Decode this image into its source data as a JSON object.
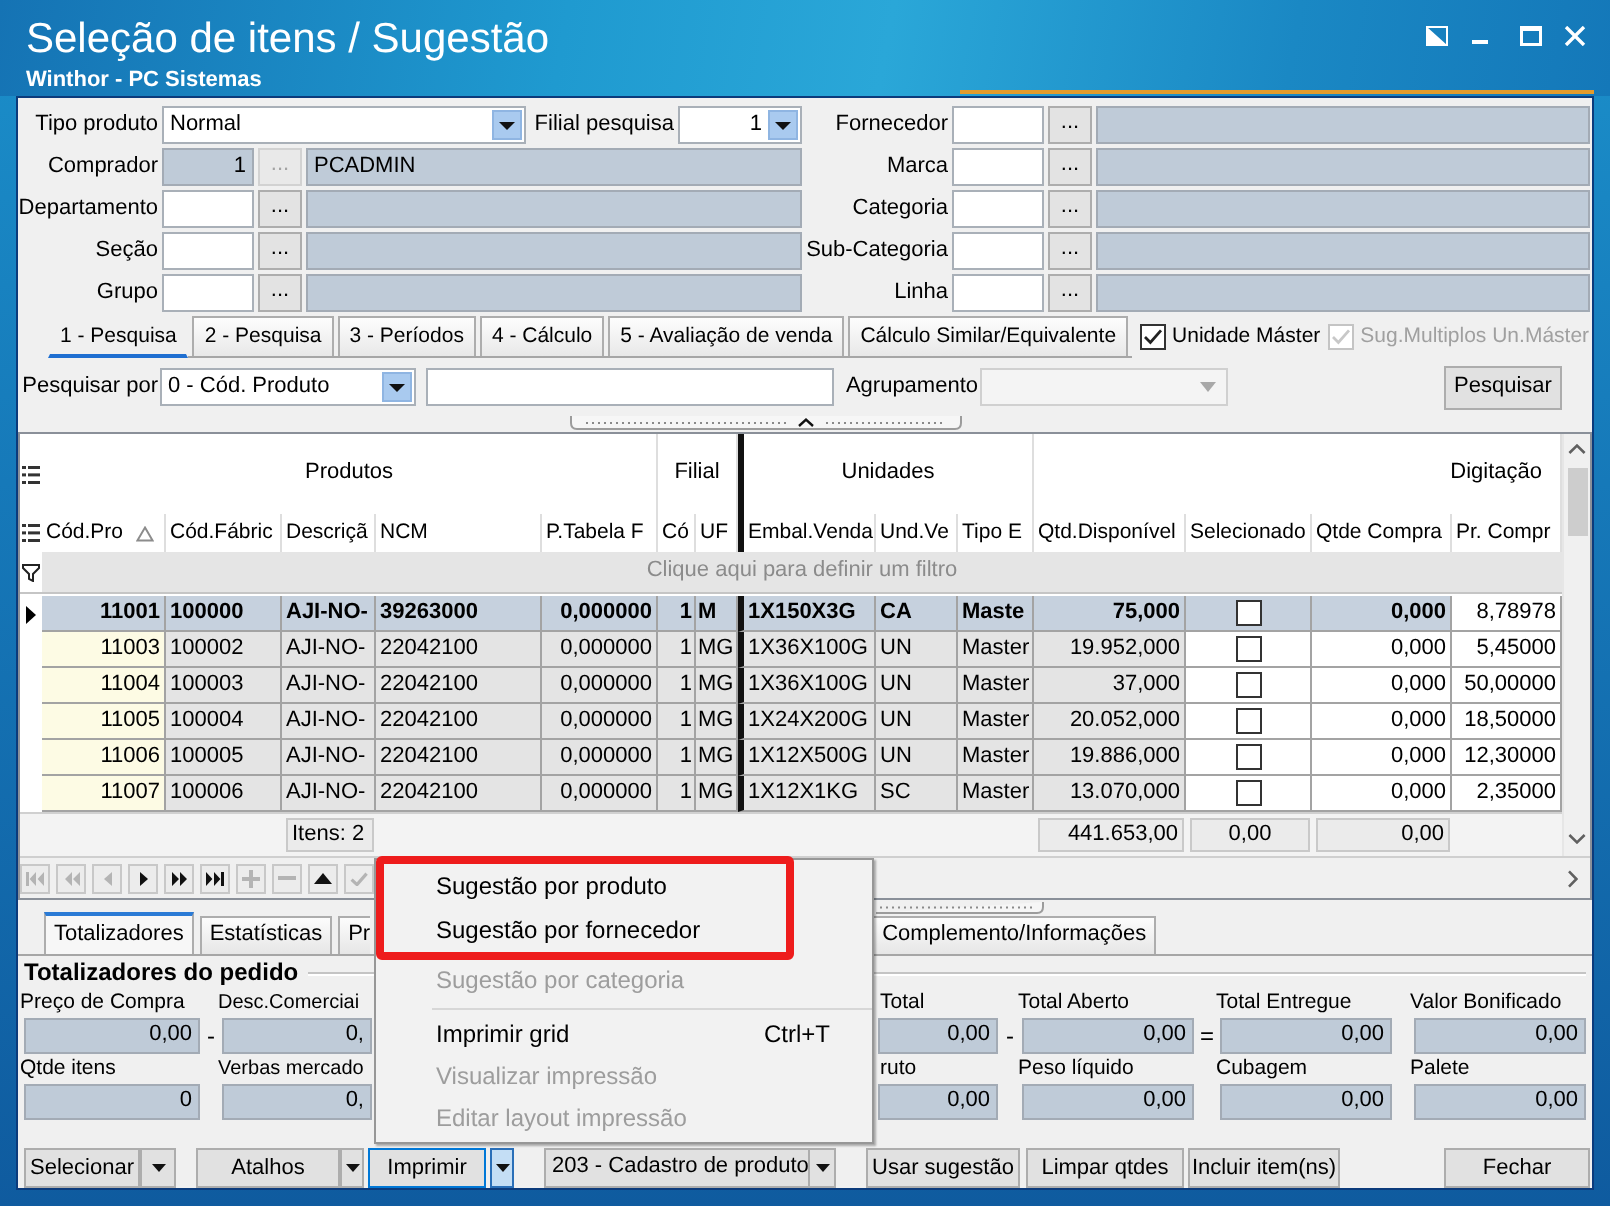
{
  "window": {
    "title": "Seleção de itens / Sugestão",
    "subtitle": "Winthor - PC Sistemas"
  },
  "filters": {
    "product_type": {
      "label": "Tipo produto",
      "value": "Normal"
    },
    "branch": {
      "label": "Filial pesquisa",
      "value": "1"
    },
    "left_lookups": [
      {
        "label": "Comprador",
        "code": "1",
        "description": "PCADMIN",
        "button": "...",
        "disabled": true
      },
      {
        "label": "Departamento",
        "button": "...",
        "disabled": false
      },
      {
        "label": "Seção",
        "button": "...",
        "disabled": false
      },
      {
        "label": "Grupo",
        "button": "...",
        "disabled": false
      }
    ],
    "right_lookups": [
      {
        "label": "Fornecedor",
        "button": "...",
        "disabled": false
      },
      {
        "label": "Marca",
        "button": "...",
        "disabled": false
      },
      {
        "label": "Categoria",
        "button": "...",
        "disabled": false
      },
      {
        "label": "Sub-Categoria",
        "button": "...",
        "disabled": false
      },
      {
        "label": "Linha",
        "button": "...",
        "disabled": false
      }
    ]
  },
  "tabs": [
    {
      "label": "1 - Pesquisa",
      "selected": true
    },
    {
      "label": "2 - Pesquisa",
      "selected": false
    },
    {
      "label": "3 - Períodos",
      "selected": false
    },
    {
      "label": "4 - Cálculo",
      "selected": false
    },
    {
      "label": "5 - Avaliação de venda",
      "selected": false
    },
    {
      "label": "Cálculo Similar/Equivalente",
      "selected": false
    }
  ],
  "options": [
    {
      "label": "Unidade Máster",
      "checked": true,
      "disabled": false
    },
    {
      "label": "Sug.Multiplos Un.Máster",
      "checked": true,
      "disabled": true
    }
  ],
  "search": {
    "label": "Pesquisar por",
    "value": "0 - Cód. Produto",
    "grouping_label": "Agrupamento",
    "grouping_disabled": true,
    "button": "Pesquisar"
  },
  "grid": {
    "bands": [
      {
        "label": "Produtos",
        "columns": [
          {
            "label": "Cód.Pro",
            "kind": "text",
            "sorted": true,
            "editable": false,
            "focused": false
          },
          {
            "label": "Cód.Fábric",
            "kind": "text",
            "sorted": false,
            "editable": false,
            "focused": false
          },
          {
            "label": "Descriçã",
            "kind": "text",
            "sorted": false,
            "editable": false,
            "focused": false,
            "footer": "Itens: 2"
          },
          {
            "label": "NCM",
            "kind": "text",
            "sorted": false,
            "editable": false,
            "focused": false
          },
          {
            "label": "P.Tabela F",
            "kind": "text",
            "sorted": false,
            "editable": false,
            "focused": false
          }
        ]
      },
      {
        "label": "Filial",
        "columns": [
          {
            "label": "Có",
            "kind": "text",
            "sorted": false,
            "editable": false,
            "focused": false
          },
          {
            "label": "UF",
            "kind": "text",
            "sorted": false,
            "editable": false,
            "focused": false
          }
        ]
      },
      {
        "label": "Unidades",
        "columns": [
          {
            "label": "Embal.Venda",
            "kind": "text",
            "sorted": false,
            "editable": false,
            "focused": false
          },
          {
            "label": "Und.Ve",
            "kind": "text",
            "sorted": false,
            "editable": false,
            "focused": false
          },
          {
            "label": "Tipo E",
            "kind": "text",
            "sorted": false,
            "editable": false,
            "focused": false
          }
        ]
      },
      {
        "label": "Digitação",
        "columns": [
          {
            "label": "Qtd.Disponível",
            "kind": "text",
            "sorted": false,
            "editable": false,
            "focused": false,
            "footer": "441.653,00"
          },
          {
            "label": "Selecionado",
            "kind": "checkbox",
            "sorted": false,
            "editable": true,
            "focused": false,
            "footer": "0,00"
          },
          {
            "label": "Qtde Compra",
            "kind": "text",
            "sorted": false,
            "editable": true,
            "focused": false,
            "footer": "0,00"
          },
          {
            "label": "Pr. Compr",
            "kind": "text",
            "sorted": false,
            "editable": true,
            "focused": true
          }
        ]
      }
    ],
    "filter_row": "Clique aqui para definir um filtro",
    "rows": [
      {
        "selected": true,
        "cells": [
          "11001",
          "100000",
          "AJI-NO-",
          "39263000",
          "0,000000",
          "1",
          "M",
          "1X150X3G",
          "CA",
          "Maste",
          "75,000",
          false,
          "0,000",
          "8,78978"
        ]
      },
      {
        "selected": false,
        "cells": [
          "11003",
          "100002",
          "AJI-NO-",
          "22042100",
          "0,000000",
          "1",
          "MG",
          "1X36X100G",
          "UN",
          "Master",
          "19.952,000",
          false,
          "0,000",
          "5,45000"
        ]
      },
      {
        "selected": false,
        "cells": [
          "11004",
          "100003",
          "AJI-NO-",
          "22042100",
          "0,000000",
          "1",
          "MG",
          "1X36X100G",
          "UN",
          "Master",
          "37,000",
          false,
          "0,000",
          "50,00000"
        ]
      },
      {
        "selected": false,
        "cells": [
          "11005",
          "100004",
          "AJI-NO-",
          "22042100",
          "0,000000",
          "1",
          "MG",
          "1X24X200G",
          "UN",
          "Master",
          "20.052,000",
          false,
          "0,000",
          "18,50000"
        ]
      },
      {
        "selected": false,
        "cells": [
          "11006",
          "100005",
          "AJI-NO-",
          "22042100",
          "0,000000",
          "1",
          "MG",
          "1X12X500G",
          "UN",
          "Master",
          "19.886,000",
          false,
          "0,000",
          "12,30000"
        ]
      },
      {
        "selected": false,
        "cells": [
          "11007",
          "100006",
          "AJI-NO-",
          "22042100",
          "0,000000",
          "1",
          "MG",
          "1X12X1KG",
          "SC",
          "Master",
          "13.070,000",
          false,
          "0,000",
          "2,35000"
        ]
      }
    ],
    "navigator": [
      {
        "kind": "first",
        "disabled": true
      },
      {
        "kind": "prior-page",
        "disabled": true
      },
      {
        "kind": "prior",
        "disabled": true
      },
      {
        "kind": "next",
        "disabled": false
      },
      {
        "kind": "next-page",
        "disabled": false
      },
      {
        "kind": "last",
        "disabled": false
      },
      {
        "kind": "insert",
        "disabled": true
      },
      {
        "kind": "delete",
        "disabled": true
      },
      {
        "kind": "edit",
        "disabled": false
      },
      {
        "kind": "post",
        "disabled": true
      }
    ]
  },
  "bottom_tabs": [
    {
      "label": "Totalizadores",
      "selected": true,
      "covered": false
    },
    {
      "label": "Estatísticas",
      "selected": false,
      "covered": false
    },
    {
      "label": "Pr",
      "selected": false,
      "covered": true
    },
    {
      "label": "Complemento/Informações",
      "selected": false,
      "covered": false
    }
  ],
  "totals": {
    "title": "Totalizadores do pedido",
    "rows": [
      [
        {
          "label": "Preço de Compra",
          "value": "0,00",
          "operator": "-",
          "covered": false
        },
        {
          "label": "Desc.Comerciai",
          "value": "0,",
          "covered": true
        },
        {
          "label": "Total",
          "value": "0,00",
          "operator": "-",
          "covered": false
        },
        {
          "label": "Total Aberto",
          "value": "0,00",
          "operator": "=",
          "covered": false
        },
        {
          "label": "Total Entregue",
          "value": "0,00",
          "covered": false
        },
        {
          "label": "Valor Bonificado",
          "value": "0,00",
          "covered": false
        }
      ],
      [
        {
          "label": "Qtde itens",
          "value": "0",
          "covered": false
        },
        {
          "label": "Verbas mercado",
          "value": "0,",
          "covered": true
        },
        {
          "label": "ruto",
          "value": "0,00",
          "covered": false
        },
        {
          "label": "Peso líquido",
          "value": "0,00",
          "covered": false
        },
        {
          "label": "Cubagem",
          "value": "0,00",
          "covered": false
        },
        {
          "label": "Palete",
          "value": "0,00",
          "covered": false
        }
      ]
    ]
  },
  "actions": [
    {
      "kind": "split",
      "label": "Selecionar",
      "active": false
    },
    {
      "kind": "split",
      "label": "Atalhos",
      "active": false
    },
    {
      "kind": "split",
      "label": "Imprimir",
      "active": true
    },
    {
      "kind": "combo",
      "value": "203 - Cadastro de produto",
      "active": false
    },
    {
      "kind": "button",
      "label": "Usar sugestão",
      "active": false
    },
    {
      "kind": "button",
      "label": "Limpar qtdes",
      "active": false
    },
    {
      "kind": "button",
      "label": "Incluir item(ns)",
      "active": false
    },
    {
      "kind": "button",
      "label": "Fechar",
      "active": false
    }
  ],
  "menu": {
    "items": [
      {
        "kind": "item",
        "label": "Sugestão por produto",
        "disabled": false,
        "highlighted": true
      },
      {
        "kind": "item",
        "label": "Sugestão por fornecedor",
        "disabled": false,
        "highlighted": true
      },
      {
        "kind": "item",
        "label": "Sugestão por categoria",
        "disabled": true,
        "highlighted": false
      },
      {
        "kind": "separator"
      },
      {
        "kind": "item",
        "label": "Imprimir grid",
        "shortcut": "Ctrl+T",
        "disabled": false,
        "highlighted": false
      },
      {
        "kind": "item",
        "label": "Visualizar impressão",
        "disabled": true,
        "highlighted": false
      },
      {
        "kind": "item",
        "label": "Editar layout impressão",
        "disabled": true,
        "highlighted": false
      }
    ]
  }
}
